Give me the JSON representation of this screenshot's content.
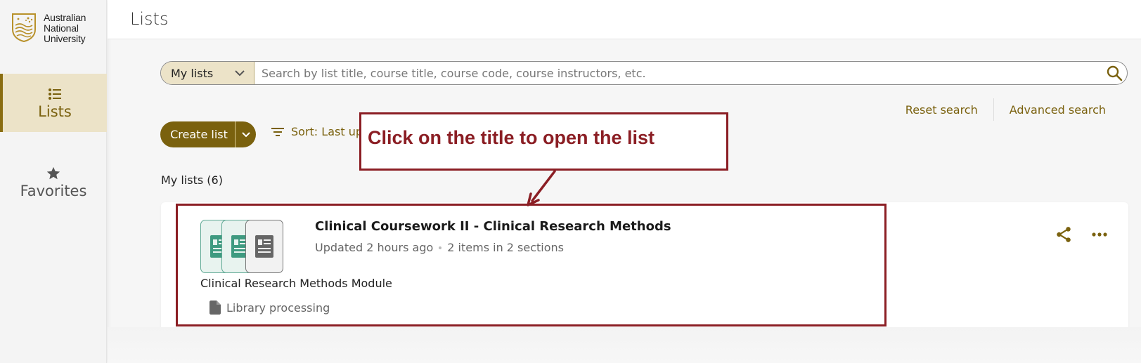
{
  "sidebar": {
    "logo_lines": [
      "Australian",
      "National",
      "University"
    ],
    "nav": {
      "lists_label": "Lists",
      "favorites_label": "Favorites"
    }
  },
  "header": {
    "title": "Lists"
  },
  "search": {
    "scope_label": "My lists",
    "placeholder": "Search by list title, course title, course code, course instructors, etc."
  },
  "actions": {
    "reset_search": "Reset search",
    "advanced_search": "Advanced search",
    "create_list": "Create list",
    "sort_label": "Sort: Last up"
  },
  "lists": {
    "count_label": "My lists (6)",
    "items": [
      {
        "title": "Clinical Coursework II - Clinical Research Methods",
        "updated": "Updated 2 hours ago",
        "items_count": "2 items in 2 sections",
        "course": "Clinical Research Methods Module",
        "status": "Library processing"
      }
    ]
  },
  "annotation": {
    "text": "Click on the title to open the list"
  },
  "colors": {
    "accent": "#7a610e",
    "accent_light": "#ece3c8",
    "annotation": "#8b1e24",
    "thumb_green": "#3e9a80"
  },
  "icons": [
    "anu-crest-icon",
    "list-icon",
    "star-icon",
    "chevron-down-icon",
    "search-icon",
    "filter-icon",
    "document-icon",
    "file-icon",
    "share-icon",
    "more-icon"
  ]
}
